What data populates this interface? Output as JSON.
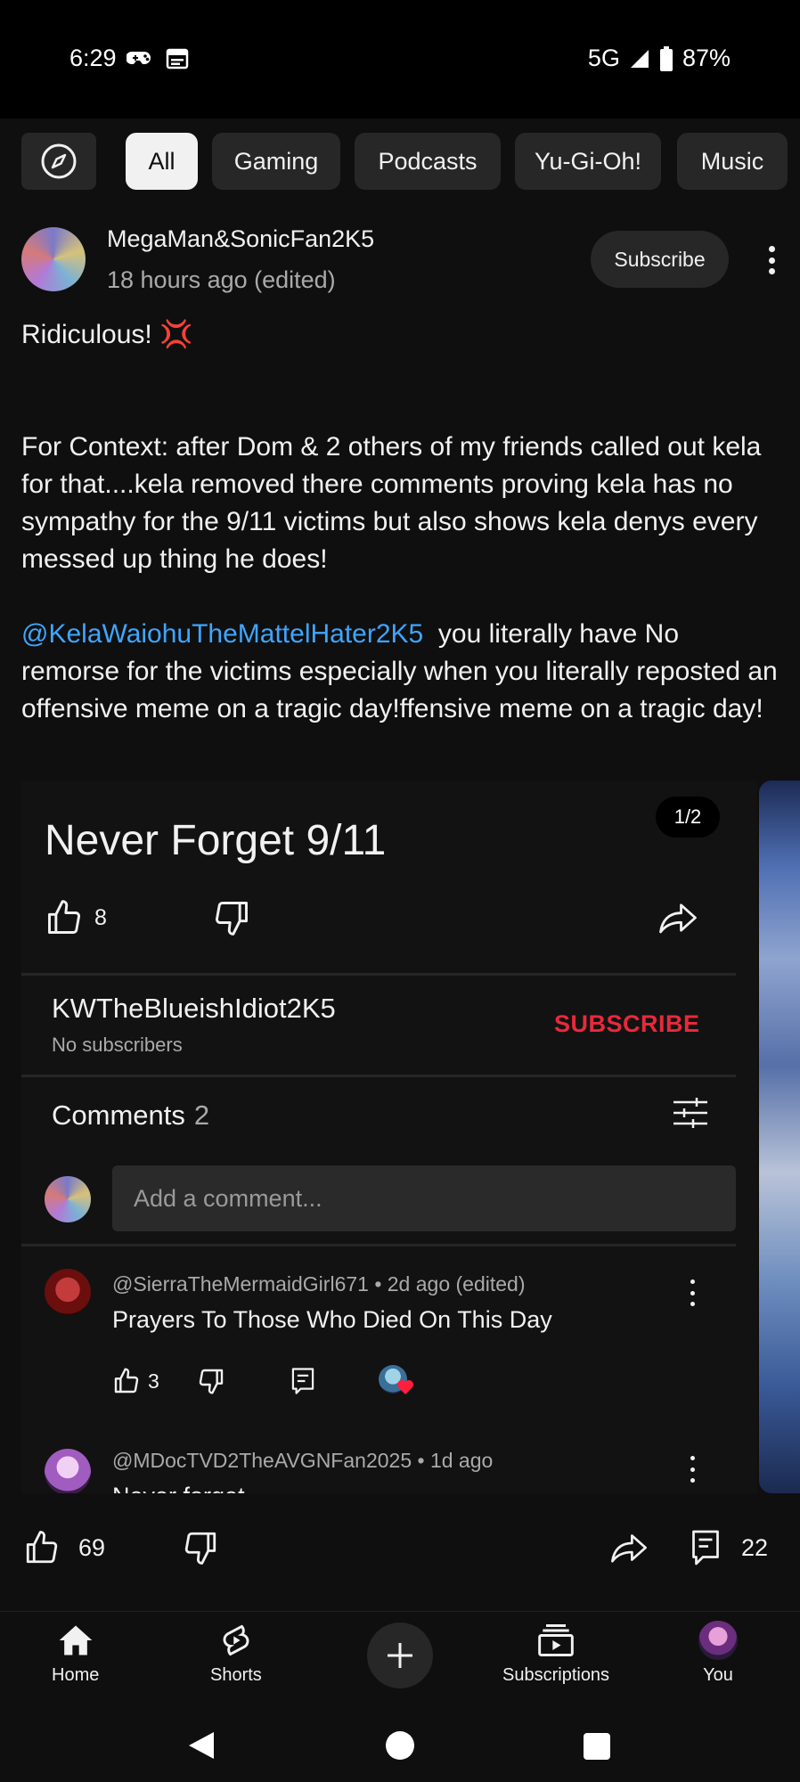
{
  "status_bar": {
    "time": "6:29",
    "network": "5G",
    "battery": "87%"
  },
  "chips": {
    "items": [
      "All",
      "Gaming",
      "Podcasts",
      "Yu-Gi-Oh!",
      "Music"
    ],
    "active": "All"
  },
  "post": {
    "author": "MegaMan&SonicFan2K5",
    "time": "18 hours ago (edited)",
    "subscribe_label": "Subscribe",
    "line1": "Ridiculous! 💢",
    "paragraph": "For Context: after Dom & 2 others of my friends called out kela for that....kela removed there comments proving kela has no sympathy for the 9/11 victims but also shows kela denys every messed up thing he does!",
    "mention": "@KelaWaiohuTheMattelHater2K5",
    "after_mention": "  you literally have No remorse for the victims especially when you literally reposted an offensive meme on a tragic day!ffensive meme on a tragic day!",
    "likes": "69",
    "comments": "22"
  },
  "image_card": {
    "counter": "1/2",
    "title": "Never Forget 9/11",
    "likes": "8",
    "channel": "KWTheBlueishIdiot2K5",
    "subscribers": "No subscribers",
    "subscribe_label": "SUBSCRIBE",
    "comments_label": "Comments",
    "comments_count": "2",
    "add_comment_placeholder": "Add a comment...",
    "comments": [
      {
        "meta": "@SierraTheMermaidGirl671 • 2d ago (edited)",
        "text": "Prayers To Those Who Died On This Day",
        "likes": "3"
      },
      {
        "meta": "@MDocTVD2TheAVGNFan2025 • 1d ago",
        "text": "Never forget"
      }
    ]
  },
  "bottom_nav": {
    "home": "Home",
    "shorts": "Shorts",
    "subscriptions": "Subscriptions",
    "you": "You"
  },
  "colors": {
    "background": "#0f0f0f",
    "chip": "#272727",
    "mention": "#3ea6ff",
    "subscribe_red": "#e8293c"
  }
}
